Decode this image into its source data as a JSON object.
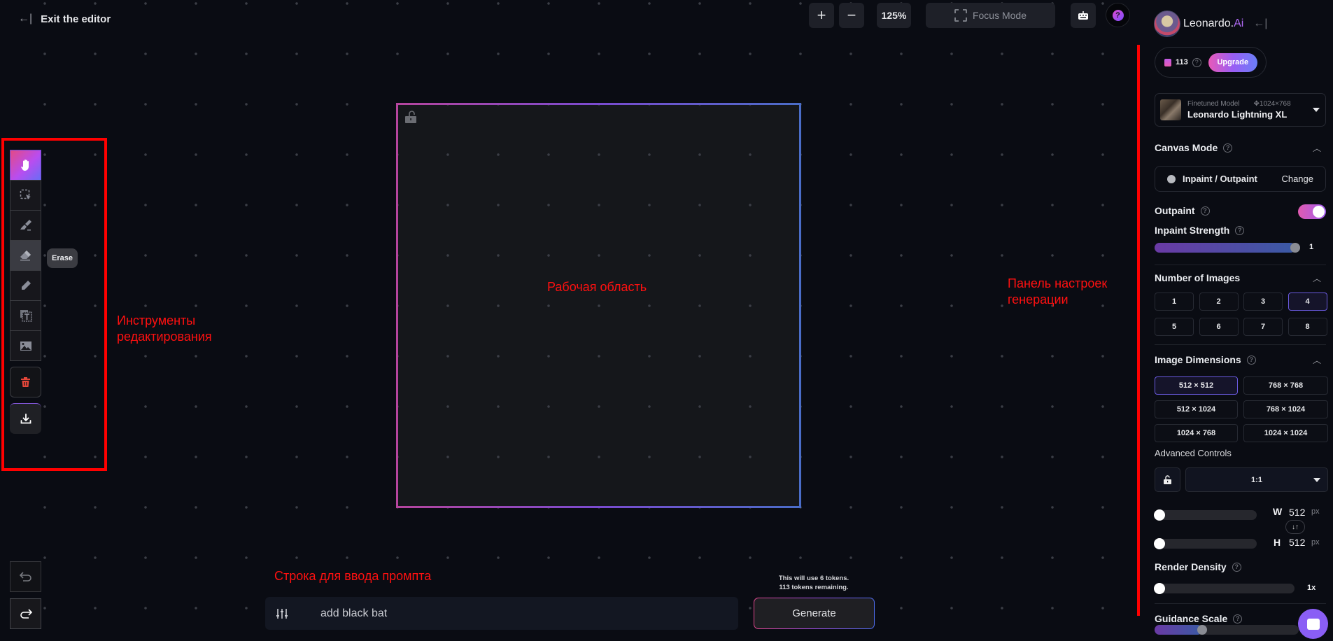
{
  "header": {
    "exit_label": "Exit the editor",
    "zoom_in": "+",
    "zoom_out": "−",
    "zoom_level": "125%",
    "focus_mode": "Focus Mode"
  },
  "tools": {
    "items": [
      {
        "name": "pan",
        "icon": "hand-icon",
        "active": true
      },
      {
        "name": "select",
        "icon": "select-icon"
      },
      {
        "name": "draw-mask",
        "icon": "brush-icon"
      },
      {
        "name": "erase",
        "icon": "eraser-icon",
        "hover": true
      },
      {
        "name": "pencil",
        "icon": "pencil-icon"
      },
      {
        "name": "text-layer",
        "icon": "text-layer-icon"
      },
      {
        "name": "image",
        "icon": "image-icon"
      }
    ],
    "tooltip": "Erase",
    "delete_icon": "trash-icon",
    "download_icon": "download-icon",
    "undo_icon": "undo-icon",
    "redo_icon": "redo-icon"
  },
  "annotations": {
    "tools_label": "Инструменты\nредактирования",
    "tools_line1": "Инструменты",
    "tools_line2": "редактирования",
    "canvas_label": "Рабочая область",
    "panel_line1": "Панель настроек",
    "panel_line2": "генерации",
    "prompt_label": "Строка для ввода промпта",
    "color": "#ff0000"
  },
  "prompt": {
    "value": "add black bat",
    "token_line1": "This will use 6 tokens.",
    "token_line2": "113 tokens remaining.",
    "generate_label": "Generate"
  },
  "panel": {
    "brand": "Leonardo.",
    "brand_ai": "Ai",
    "credits": "113",
    "upgrade": "Upgrade",
    "model": {
      "type": "Finetuned Model",
      "resolution": "1024×768",
      "name": "Leonardo Lightning XL"
    },
    "canvas_mode": {
      "title": "Canvas Mode",
      "mode": "Inpaint / Outpaint",
      "change": "Change"
    },
    "outpaint": {
      "label": "Outpaint",
      "enabled": true
    },
    "inpaint_strength": {
      "label": "Inpaint Strength",
      "value": "1",
      "fraction": 1.0
    },
    "num_images": {
      "title": "Number of Images",
      "options": [
        "1",
        "2",
        "3",
        "4",
        "5",
        "6",
        "7",
        "8"
      ],
      "selected": "4"
    },
    "dimensions": {
      "title": "Image Dimensions",
      "options": [
        "512 × 512",
        "768 × 768",
        "512 × 1024",
        "768 × 1024",
        "1024 × 768",
        "1024 × 1024"
      ],
      "selected": "512 × 512",
      "advanced_label": "Advanced Controls",
      "aspect_ratio": "1:1",
      "width_label": "W",
      "width": "512",
      "height_label": "H",
      "height": "512",
      "unit": "px"
    },
    "render_density": {
      "label": "Render Density",
      "value": "1x",
      "fraction": 0.0
    },
    "guidance_scale": {
      "label": "Guidance Scale",
      "fraction": 0.32
    }
  },
  "colors": {
    "accent_purple": "#a25ef0",
    "accent_pink": "#e05ab0",
    "background": "#0a0c13",
    "delete_red": "#e5473a"
  }
}
